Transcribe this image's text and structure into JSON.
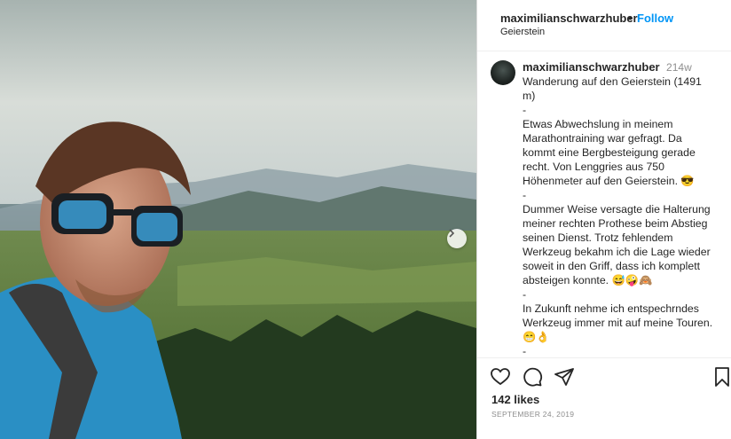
{
  "post": {
    "image_alt": "Selfie of a man with sunglasses overlooking an alpine valley",
    "next_icon": "chevron-right-icon"
  },
  "header": {
    "username": "maximilianschwarzhuber",
    "separator": "•",
    "follow_label": "Follow",
    "location": "Geierstein"
  },
  "caption": {
    "username": "maximilianschwarzhuber",
    "age": "214w",
    "lines": [
      "Wanderung auf den Geierstein (1491 m)",
      "-",
      "Etwas Abwechslung in meinem Marathontraining war gefragt. Da kommt eine Bergbesteigung gerade recht. Von Lenggries aus 750 Höhenmeter auf den Geierstein. 😎",
      "-",
      "Dummer Weise versagte die Halterung meiner rechten Prothese beim Abstieg seinen Dienst. Trotz fehlendem Werkzeug bekahm ich die Lage wieder soweit in den Griff, dass ich komplett absteigen konnte. 😅🤪🙈",
      "-",
      "In Zukunft nehme ich entspechrndes Werkzeug immer mit auf meine Touren. 😁👌",
      "-"
    ]
  },
  "actions": {
    "like_icon": "heart-icon",
    "comment_icon": "comment-icon",
    "share_icon": "share-icon",
    "save_icon": "bookmark-icon"
  },
  "likes": "142 likes",
  "date": "SEPTEMBER 24, 2019"
}
